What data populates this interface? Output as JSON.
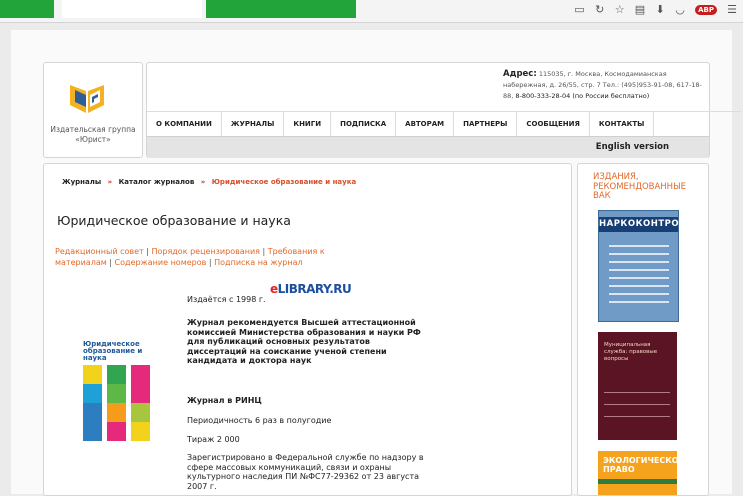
{
  "browser": {
    "icons": [
      "reader-icon",
      "reload-icon",
      "star-icon",
      "clipboard-icon",
      "download-icon",
      "pocket-icon",
      "adblock-icon",
      "menu-icon"
    ],
    "adblock_label": "ABP"
  },
  "logo": {
    "caption": "Издательская группа «Юрист»"
  },
  "header": {
    "address_label": "Адрес:",
    "address_text": "115035, г. Москва, Космодамианская набережная, д. 26/55, стр. 7 Тел.: (495)953-91-08, 617-18-88,",
    "hotline": "8-800-333-28-04 (по России бесплатно)",
    "english": "English version"
  },
  "nav": [
    "О КОМПАНИИ",
    "ЖУРНАЛЫ",
    "КНИГИ",
    "ПОДПИСКА",
    "АВТОРАМ",
    "ПАРТНЕРЫ",
    "СООБЩЕНИЯ",
    "КОНТАКТЫ"
  ],
  "breadcrumb": {
    "items": [
      "Журналы",
      "Каталог журналов"
    ],
    "separator": "»",
    "current": "Юридическое образование и наука"
  },
  "page": {
    "title": "Юридическое образование и наука",
    "links": [
      "Редакционный совет",
      "Порядок рецензирования",
      "Требования к материалам",
      "Содержание номеров",
      "Подписка на журнал"
    ],
    "link_separator": "|"
  },
  "cover": {
    "title": "Юридическое образование и наука",
    "tile_colors": [
      "#f2d21b",
      "#31a550",
      "#e5297b",
      "#1fa1d8",
      "#5cb947",
      "#e5297b",
      "#2c7ec1",
      "#f59c1a",
      "#a8c63d",
      "#2c7ec1",
      "#e5297b",
      "#f2d21b"
    ]
  },
  "info": {
    "since": "Издаётся с 1998 г.",
    "recommended": "Журнал рекомендуется Высшей аттестационной комиссией Министерства образования и науки РФ для публикаций основных результатов диссертаций на соискание ученой степени кандидата и доктора наук",
    "rinc": "Журнал в РИНЦ",
    "elibrary_e": "e",
    "elibrary_rest": "LIBRARY.RU",
    "frequency": "Периодичность 6 раз в полугодие",
    "circulation": "Тираж 2 000",
    "registration": "Зарегистрировано в Федеральной службе по надзору в сфере массовых коммуникаций, связи и охраны культурного наследия ПИ №ФС77-29362 от 23 августа 2007 г."
  },
  "sidebar": {
    "title": "ИЗДАНИЯ, РЕКОМЕНДОВАННЫЕ ВАК",
    "magazines": [
      {
        "title": "НАРКОКОНТРОЛЬ",
        "color": "#6f9bc6"
      },
      {
        "title": "Муниципальная служба: правовые вопросы",
        "color": "#5a1424"
      },
      {
        "title": "ЭКОЛОГИЧЕСКОЕ ПРАВО",
        "color": "#f5a31c"
      }
    ]
  }
}
